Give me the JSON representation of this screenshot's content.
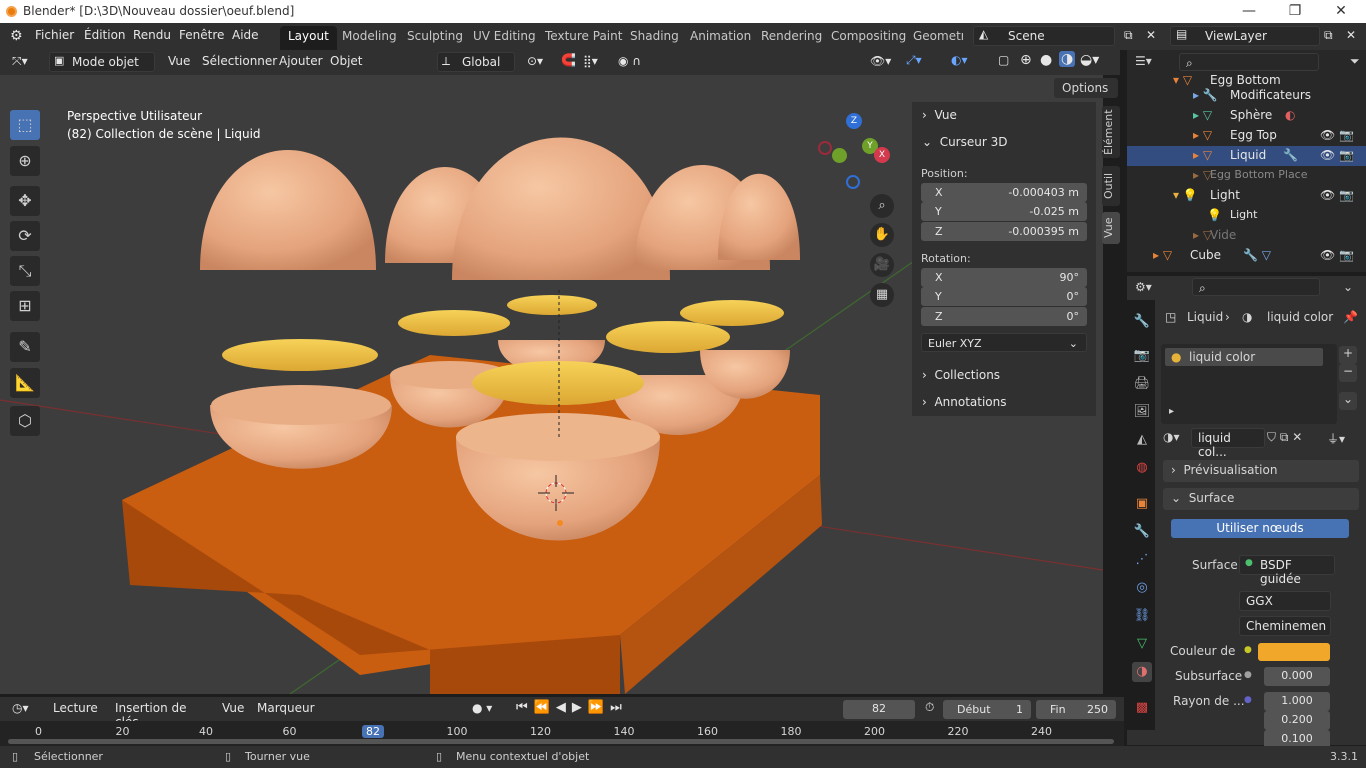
{
  "window": {
    "title": "Blender* [D:\\3D\\Nouveau dossier\\oeuf.blend]",
    "controls": [
      "—",
      "❐",
      "✕"
    ]
  },
  "menus": [
    "Fichier",
    "Édition",
    "Rendu",
    "Fenêtre",
    "Aide"
  ],
  "workspaces": [
    "Layout",
    "Modeling",
    "Sculpting",
    "UV Editing",
    "Texture Paint",
    "Shading",
    "Animation",
    "Rendering",
    "Compositing",
    "Geometry"
  ],
  "scene": "Scene",
  "view_layer": "ViewLayer",
  "header3d": {
    "mode": "Mode objet",
    "menus": [
      "Vue",
      "Sélectionner",
      "Ajouter",
      "Objet"
    ],
    "orientation": "Global",
    "options": "Options"
  },
  "viewport": {
    "line1": "Perspective Utilisateur",
    "line2": "(82) Collection de scène | Liquid"
  },
  "gizmo": {
    "x": "X",
    "y": "Y",
    "z": "Z"
  },
  "npanel": {
    "vue": "Vue",
    "cursor": "Curseur 3D",
    "position_label": "Position:",
    "position": [
      {
        "axis": "X",
        "value": "-0.000403 m"
      },
      {
        "axis": "Y",
        "value": "-0.025 m"
      },
      {
        "axis": "Z",
        "value": "-0.000395 m"
      }
    ],
    "rotation_label": "Rotation:",
    "rotation": [
      {
        "axis": "X",
        "value": "90°"
      },
      {
        "axis": "Y",
        "value": "0°"
      },
      {
        "axis": "Z",
        "value": "0°"
      }
    ],
    "rotation_mode": "Euler XYZ",
    "collections": "Collections",
    "annotations": "Annotations",
    "tabs": [
      "Élément",
      "Outil",
      "Vue"
    ]
  },
  "outliner": {
    "rows": [
      {
        "label": "Egg Bottom",
        "indent": 1
      },
      {
        "label": "Modificateurs",
        "indent": 2
      },
      {
        "label": "Sphère",
        "indent": 2
      },
      {
        "label": "Egg Top",
        "indent": 2
      },
      {
        "label": "Liquid",
        "indent": 2
      },
      {
        "label": "Egg Bottom Place",
        "indent": 1
      },
      {
        "label": "Light",
        "indent": 1
      },
      {
        "label": "Light",
        "indent": 2
      },
      {
        "label": "Vide",
        "indent": 1
      },
      {
        "label": "Cube",
        "indent": 0
      }
    ]
  },
  "properties": {
    "breadcrumb_obj": "Liquid",
    "breadcrumb_mat": "liquid color",
    "slot": "liquid color",
    "material_field": "liquid col...",
    "previsualisation": "Prévisualisation",
    "surface_section": "Surface",
    "use_nodes": "Utiliser nœuds",
    "surface_label": "Surface",
    "surface_value": "BSDF guidée",
    "distribution": "GGX",
    "subsurface_method": "Cheminemen",
    "couleur_label": "Couleur de",
    "couleur_color": "#f0a72a",
    "subsurface_label": "Subsurface",
    "subsurface_value": "0.000",
    "rayon_label": "Rayon de ...",
    "rayon_values": [
      "1.000",
      "0.200",
      "0.100"
    ]
  },
  "timeline": {
    "menus": [
      "Lecture",
      "Insertion de clés",
      "Vue",
      "Marqueur"
    ],
    "current_frame": "82",
    "start_label": "Début",
    "start": "1",
    "end_label": "Fin",
    "end": "250",
    "ticks": [
      "0",
      "20",
      "40",
      "60",
      "82",
      "100",
      "120",
      "140",
      "160",
      "180",
      "200",
      "220",
      "240"
    ]
  },
  "status": {
    "left": "Sélectionner",
    "mid": "Tourner vue",
    "right": "Menu contextuel d'objet",
    "version": "3.3.1"
  }
}
